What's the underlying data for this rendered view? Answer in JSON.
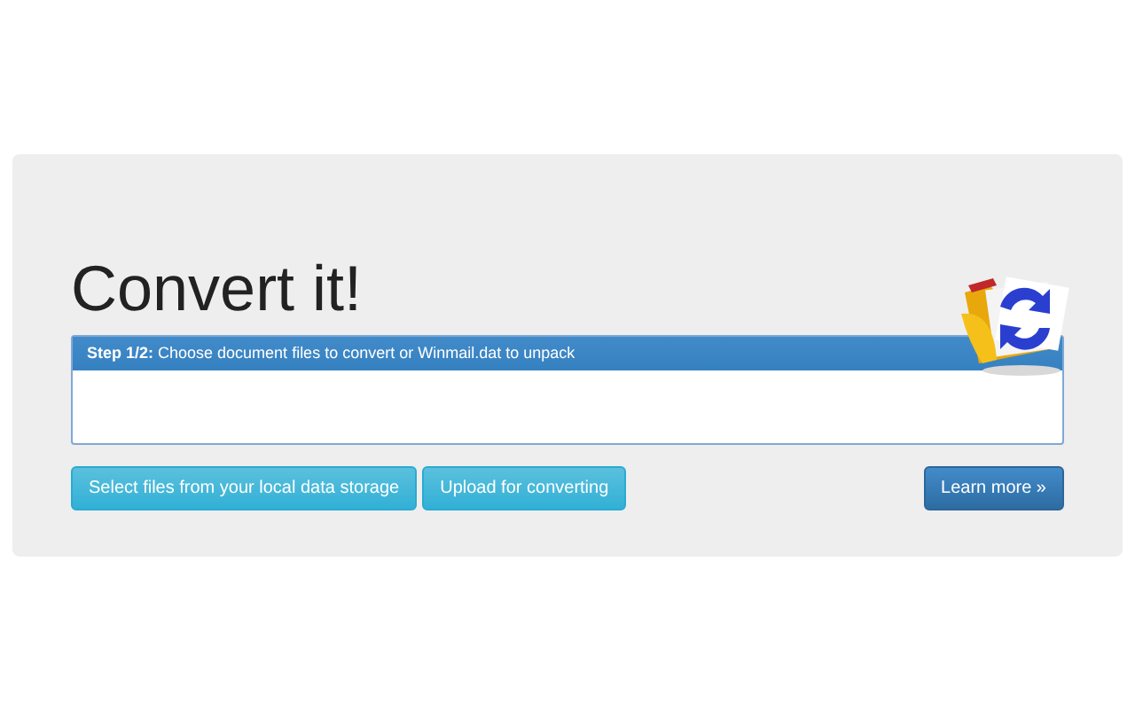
{
  "title": "Convert it!",
  "panel": {
    "heading": "**Step 1/2:** Choose document files to convert or Winmail.dat to unpack"
  },
  "buttons": [
    {
      "label": "Select files from your local data storage",
      "kind": "info"
    },
    {
      "label": "Upload for converting",
      "kind": "info"
    },
    {
      "label": "Learn more »",
      "kind": "primary"
    }
  ]
}
